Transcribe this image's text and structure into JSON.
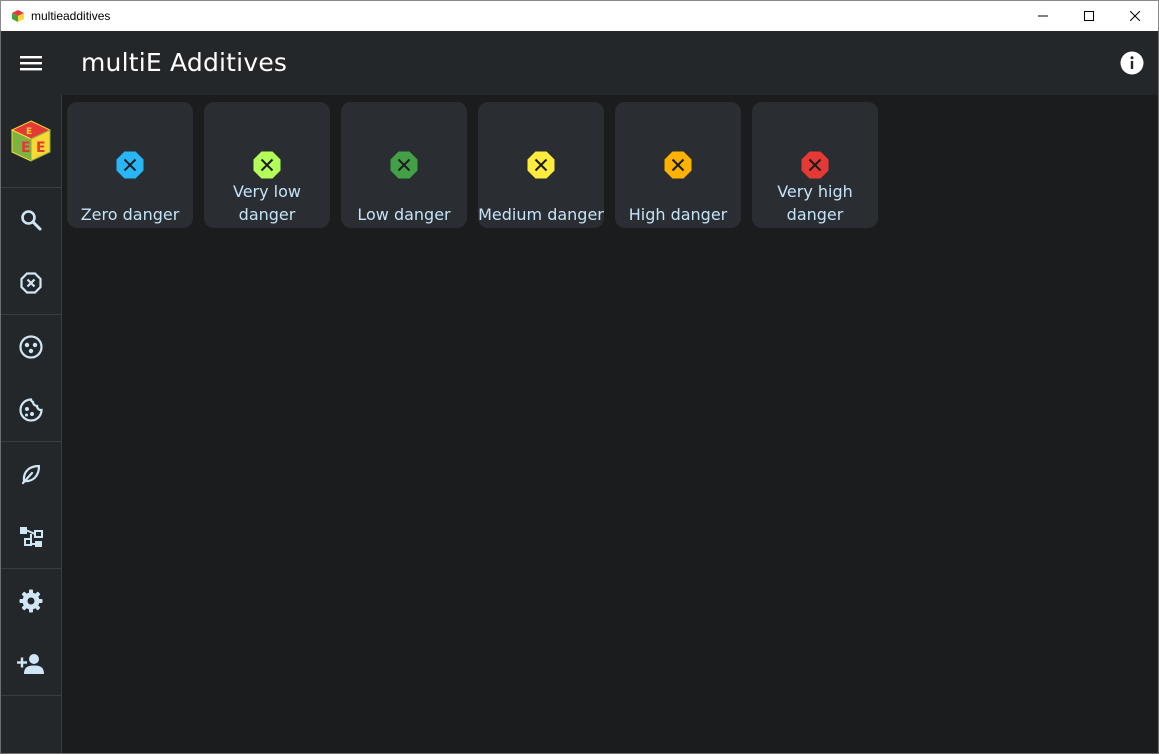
{
  "window": {
    "title": "multieadditives"
  },
  "appbar": {
    "title": "multiE Additives",
    "menu_icon": "hamburger-menu-icon",
    "info_icon": "info-icon"
  },
  "sidebar": {
    "logo": "multie-cube-logo",
    "groups": [
      [
        {
          "name": "search",
          "icon": "search-icon"
        },
        {
          "name": "danger-levels",
          "icon": "x-octagon-icon"
        }
      ],
      [
        {
          "name": "categories",
          "icon": "dots-circle-icon"
        },
        {
          "name": "diet",
          "icon": "cookie-icon"
        }
      ],
      [
        {
          "name": "natural",
          "icon": "leaf-icon"
        },
        {
          "name": "hierarchy",
          "icon": "hierarchy-icon"
        }
      ],
      [
        {
          "name": "settings",
          "icon": "gear-icon"
        },
        {
          "name": "account",
          "icon": "add-user-icon"
        }
      ]
    ]
  },
  "danger_levels": [
    {
      "label_lines": [
        "Zero danger"
      ],
      "color": "#29b6f6"
    },
    {
      "label_lines": [
        "Very low",
        "danger"
      ],
      "color": "#b2ff59"
    },
    {
      "label_lines": [
        "Low danger"
      ],
      "color": "#43a047"
    },
    {
      "label_lines": [
        "Medium danger"
      ],
      "color": "#ffeb3b"
    },
    {
      "label_lines": [
        "High danger"
      ],
      "color": "#ffb300"
    },
    {
      "label_lines": [
        "Very high",
        "danger"
      ],
      "color": "#e53935"
    }
  ]
}
